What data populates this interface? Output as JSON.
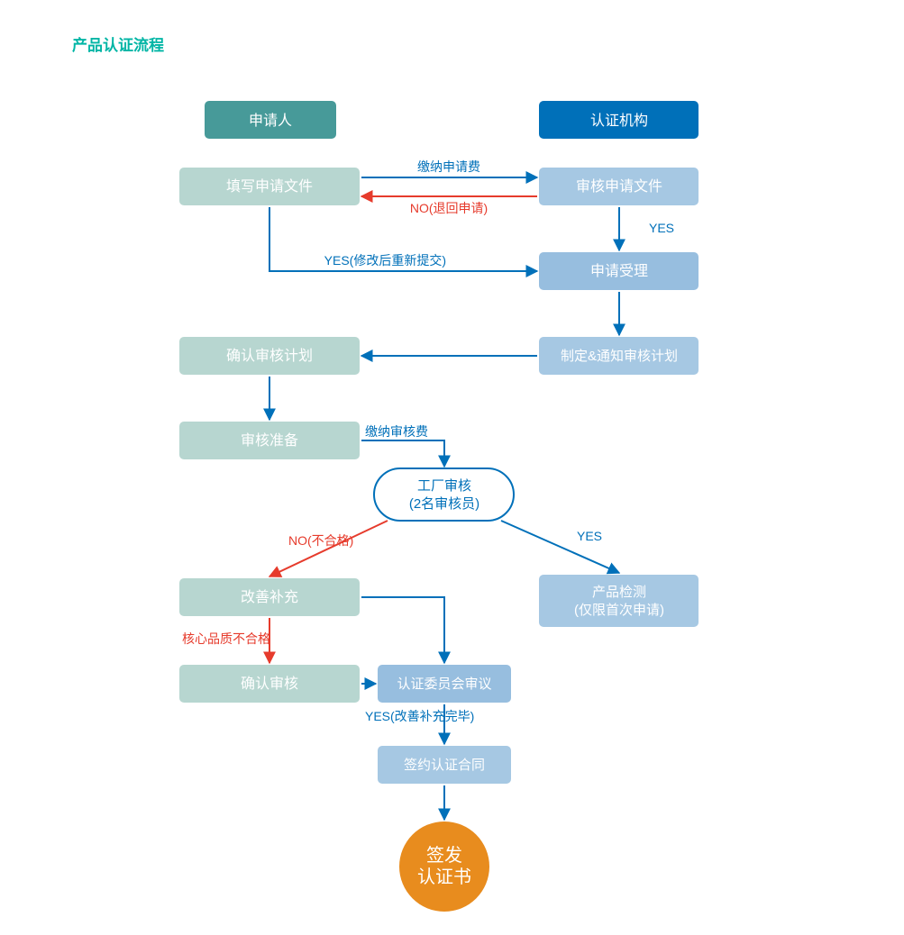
{
  "title": "产品认证流程",
  "headers": {
    "applicant": "申请人",
    "agency": "认证机构"
  },
  "boxes": {
    "fill_application": "填写申请文件",
    "review_application": "审核申请文件",
    "accept_application": "申请受理",
    "confirm_plan": "确认审核计划",
    "make_notify_plan": "制定&通知审核计划",
    "audit_prep": "审核准备",
    "improvement": "改善补充",
    "confirm_audit": "确认审核",
    "committee_review": "认证委员会审议",
    "sign_contract": "签约认证合同",
    "product_test_line1": "产品检测",
    "product_test_line2": "(仅限首次申请)"
  },
  "decision": {
    "factory_audit_line1": "工厂审核",
    "factory_audit_line2": "(2名审核员)"
  },
  "final": {
    "issue_cert_line1": "签发",
    "issue_cert_line2": "认证书"
  },
  "edge_labels": {
    "pay_application_fee": "缴纳申请费",
    "return_no": "NO(退回申请)",
    "yes_afterReview": "YES",
    "yes_resubmit": "YES(修改后重新提交)",
    "pay_audit_fee": "缴纳审核费",
    "no_fail": "NO(不合格)",
    "yes_after_audit": "YES",
    "core_fail": "核心品质不合格",
    "yes_improve_done": "YES(改善补充完毕)"
  }
}
